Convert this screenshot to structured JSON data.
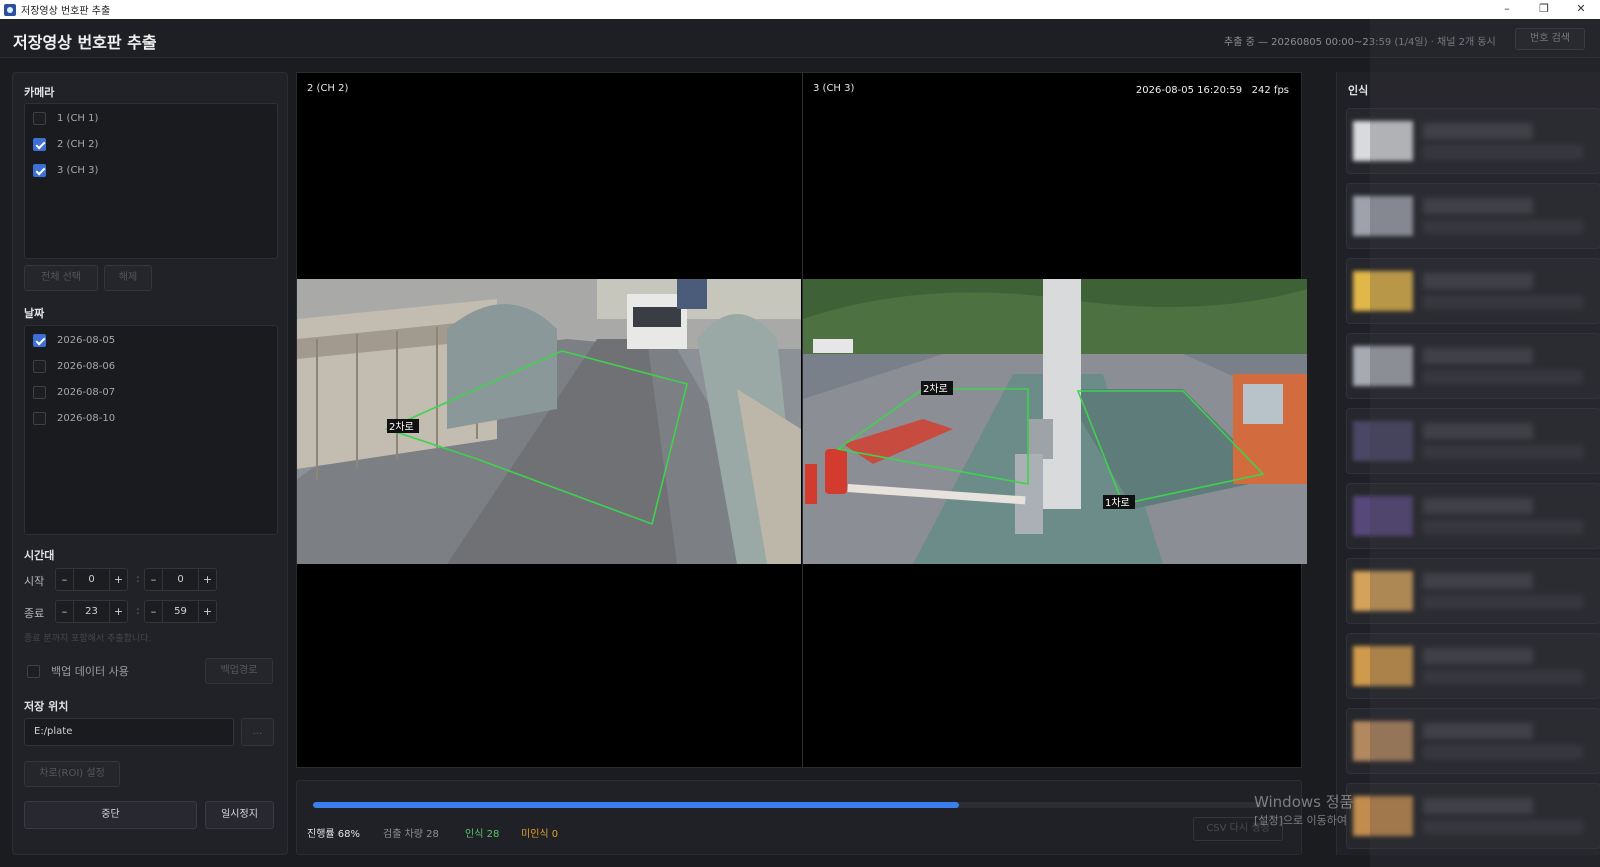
{
  "window": {
    "title": "저장영상 번호판 추출",
    "minimize": "–",
    "restore": "❐",
    "close": "✕"
  },
  "header": {
    "title": "저장영상 번호판 추출",
    "progress_text": "추출 중 — 20260805 00:00~23:59 (1/4일) · 채널 2개 동시",
    "plate_search_label": "번호 검색"
  },
  "left": {
    "camera_title": "카메라",
    "cameras": [
      {
        "label": "1  (CH 1)",
        "checked": false
      },
      {
        "label": "2  (CH 2)",
        "checked": true
      },
      {
        "label": "3  (CH 3)",
        "checked": true
      }
    ],
    "select_all": "전체 선택",
    "deselect": "해제",
    "date_title": "날짜",
    "dates": [
      {
        "label": "2026-08-05",
        "checked": true
      },
      {
        "label": "2026-08-06",
        "checked": false
      },
      {
        "label": "2026-08-07",
        "checked": false
      },
      {
        "label": "2026-08-10",
        "checked": false
      }
    ],
    "time_title": "시간대",
    "start_label": "시작",
    "end_label": "종료",
    "start_hour": "0",
    "start_min": "0",
    "end_hour": "23",
    "end_min": "59",
    "minus": "–",
    "plus": "+",
    "colon": ":",
    "time_hint": "종료 분까지 포함해서 추출합니다.",
    "backup_label": "백업 데이터 사용",
    "backup_path_btn": "백업경로",
    "save_title": "저장 위치",
    "save_path": "E:/plate",
    "browse": "...",
    "roi_btn": "차로(ROI) 설정",
    "stop_btn": "중단",
    "pause_btn": "일시정지"
  },
  "video": {
    "left_cam": "2  (CH 2)",
    "right_cam": "3  (CH 3)",
    "timestamp": "2026-08-05 16:20:59",
    "fps": "242 fps",
    "lane_left": "2차로",
    "lane_right_a": "2차로",
    "lane_right_b": "1차로"
  },
  "status": {
    "progress": 0.68,
    "progress_label": "진행률 68%",
    "detected_label": "검출 차량",
    "detected": "28",
    "recognized_label": "인식",
    "recognized": "28",
    "unrecognized_label": "미인식",
    "unrecognized": "0",
    "csv_btn": "CSV 다시 생성"
  },
  "right": {
    "title": "인식",
    "thumb_colors": [
      "#d9dadd",
      "#9fa2ab",
      "#e2b74a",
      "#a7aab2",
      "#4a4666",
      "#57487a",
      "#d4a25a",
      "#cf9a4c",
      "#b2885f",
      "#c28c4e"
    ]
  },
  "watermark": {
    "line1": "Windows 정품",
    "line2": "[설정]으로 이동하여"
  },
  "colors": {
    "accent": "#3a7ef0",
    "recognized": "#59c46a",
    "unrecognized": "#e0a030",
    "roi": "#3fd24e"
  }
}
